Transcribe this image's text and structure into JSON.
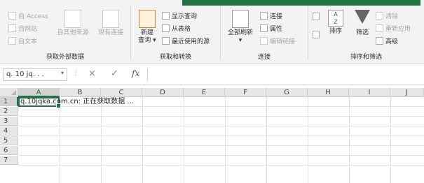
{
  "ribbon": {
    "get_external": {
      "label": "获取外部数据",
      "access": "自 Access",
      "web": "自网站",
      "text": "自文本",
      "other": "自其他来源",
      "existing": "现有连接"
    },
    "get_transform": {
      "label": "获取和转换",
      "new_query_line1": "新建",
      "new_query_line2": "查询 ▾",
      "show_queries": "显示查询",
      "from_table": "从表格",
      "recent_sources": "最近使用的源"
    },
    "connections": {
      "label": "连接",
      "refresh_all": "全部刷新",
      "refresh_arrow": "▾",
      "connections": "连接",
      "properties": "属性",
      "edit_links": "编辑链接"
    },
    "sort_filter": {
      "label": "排序和筛选",
      "sort": "排序",
      "filter": "筛选",
      "clear": "清除",
      "reapply": "重新应用",
      "advanced": "高级",
      "sort_az_top": "A",
      "sort_az_bottom": "Z"
    }
  },
  "formula_bar": {
    "name_box": "q. 10 jq. . .",
    "name_dropdown": "▾",
    "dots": "⋮",
    "cancel_icon": "×",
    "enter_icon": "✓",
    "fx_label": "fx",
    "content": ""
  },
  "sheet": {
    "columns": [
      "A",
      "B",
      "C",
      "D",
      "E",
      "F",
      "G",
      "H",
      "I",
      "J"
    ],
    "rows": [
      "1",
      "2",
      "3",
      "4",
      "5",
      "6",
      "7"
    ],
    "cell_a1": "q.10jqka.com.cn: 正在获取数据 ..."
  },
  "colors": {
    "accent": "#217346"
  }
}
